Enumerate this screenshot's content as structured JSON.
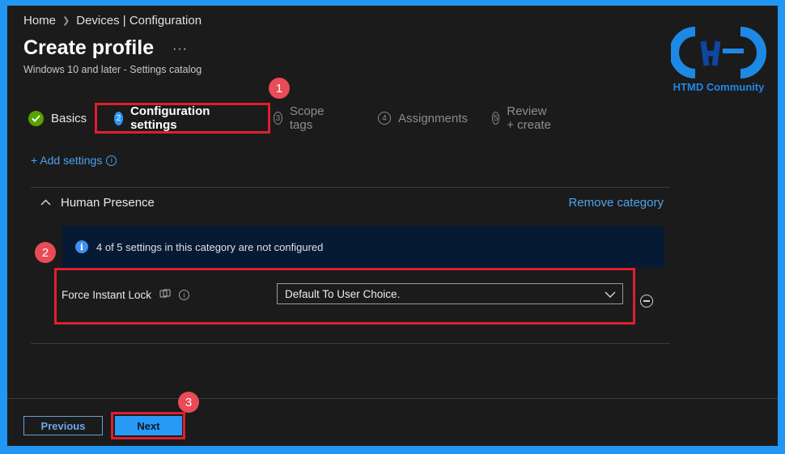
{
  "breadcrumb": {
    "home": "Home",
    "current": "Devices | Configuration"
  },
  "header": {
    "title": "Create profile",
    "more": "···",
    "subtitle": "Windows 10 and later - Settings catalog"
  },
  "logo": {
    "text": "HTMD Community"
  },
  "steps": [
    {
      "label": "Basics",
      "state": "done"
    },
    {
      "num": "2",
      "label": "Configuration settings",
      "state": "active"
    },
    {
      "num": "3",
      "label": "Scope tags",
      "state": "disabled"
    },
    {
      "num": "4",
      "label": "Assignments",
      "state": "disabled"
    },
    {
      "num": "5",
      "label": "Review + create",
      "state": "disabled"
    }
  ],
  "annotations": {
    "b1": "1",
    "b2": "2",
    "b3": "3"
  },
  "add_settings": {
    "label": "+ Add settings",
    "info": "i"
  },
  "category": {
    "title": "Human Presence",
    "remove_label": "Remove category"
  },
  "notice": {
    "icon": "i",
    "text": "4 of 5 settings in this category are not configured"
  },
  "setting": {
    "label": "Force Instant Lock",
    "value": "Default To User Choice."
  },
  "footer": {
    "previous": "Previous",
    "next": "Next"
  },
  "colors": {
    "accent": "#2899f5",
    "annotation_red": "#e01e2e",
    "success": "#57a300",
    "frame": "#2196f3"
  }
}
